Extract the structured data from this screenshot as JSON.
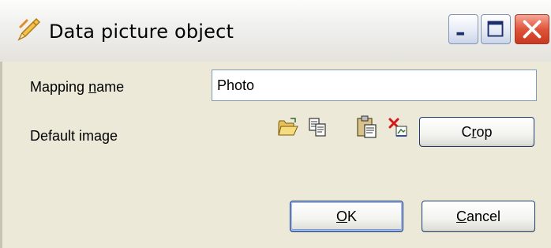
{
  "window": {
    "title": "Data picture object",
    "title_icon": "pencil-icon",
    "caption_buttons": [
      "minimize",
      "maximize",
      "close"
    ]
  },
  "form": {
    "mapping_label_pre": "Mapping ",
    "mapping_label_accel": "n",
    "mapping_label_post": "ame",
    "mapping_value": "Photo",
    "default_image_label": "Default image",
    "toolbar_icons": [
      "open-folder-icon",
      "copy-icon",
      "paste-icon",
      "delete-icon"
    ],
    "crop_label_pre": "C",
    "crop_label_accel": "r",
    "crop_label_post": "op"
  },
  "actions": {
    "ok_label_accel": "O",
    "ok_label_post": "K",
    "cancel_label_accel": "C",
    "cancel_label_post": "ancel"
  },
  "colors": {
    "face": "#ece9d8",
    "titlebar": "#f0f0ee",
    "close_red": "#e0543a",
    "input_border": "#7f9db9"
  }
}
